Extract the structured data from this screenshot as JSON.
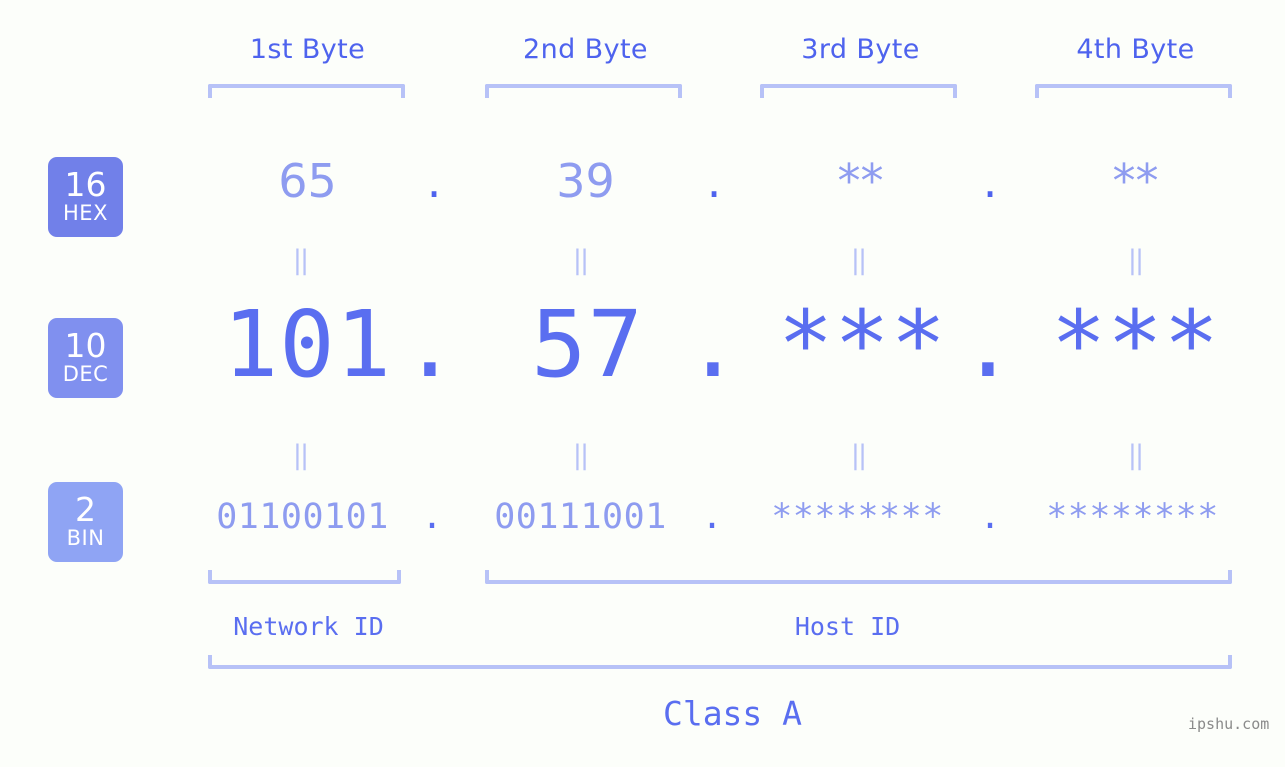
{
  "background_color": "#fcfefa",
  "accent_colors": {
    "strong_blue": "#4e63ee",
    "mid_blue": "#5a6ef0",
    "light_blue": "#8e9cf0",
    "bracket_blue": "#b7c2f7",
    "badge_hex": "#7180e9",
    "badge_dec": "#8090ef",
    "badge_bin": "#8fa4f4",
    "watermark_gray": "#8a8a8a"
  },
  "byte_headers": [
    {
      "label": "1st Byte"
    },
    {
      "label": "2nd Byte"
    },
    {
      "label": "3rd Byte"
    },
    {
      "label": "4th Byte"
    }
  ],
  "base_badges": [
    {
      "number": "16",
      "name": "HEX"
    },
    {
      "number": "10",
      "name": "DEC"
    },
    {
      "number": "2",
      "name": "BIN"
    }
  ],
  "rows": {
    "hex": {
      "base_number": "16",
      "base_name": "HEX",
      "values": [
        "65",
        "39",
        "**",
        "**"
      ],
      "separator": "."
    },
    "dec": {
      "base_number": "10",
      "base_name": "DEC",
      "values": [
        "101",
        "57",
        "***",
        "***"
      ],
      "separator": "."
    },
    "bin": {
      "base_number": "2",
      "base_name": "BIN",
      "values": [
        "01100101",
        "00111001",
        "********",
        "********"
      ],
      "separator": "."
    }
  },
  "equals_marks": {
    "glyph": "||",
    "count_per_row": 4,
    "rows": 2
  },
  "segments": {
    "network_id": {
      "label": "Network ID"
    },
    "host_id": {
      "label": "Host ID"
    },
    "class": {
      "label": "Class A"
    }
  },
  "watermark": {
    "text": "ipshu.com"
  }
}
